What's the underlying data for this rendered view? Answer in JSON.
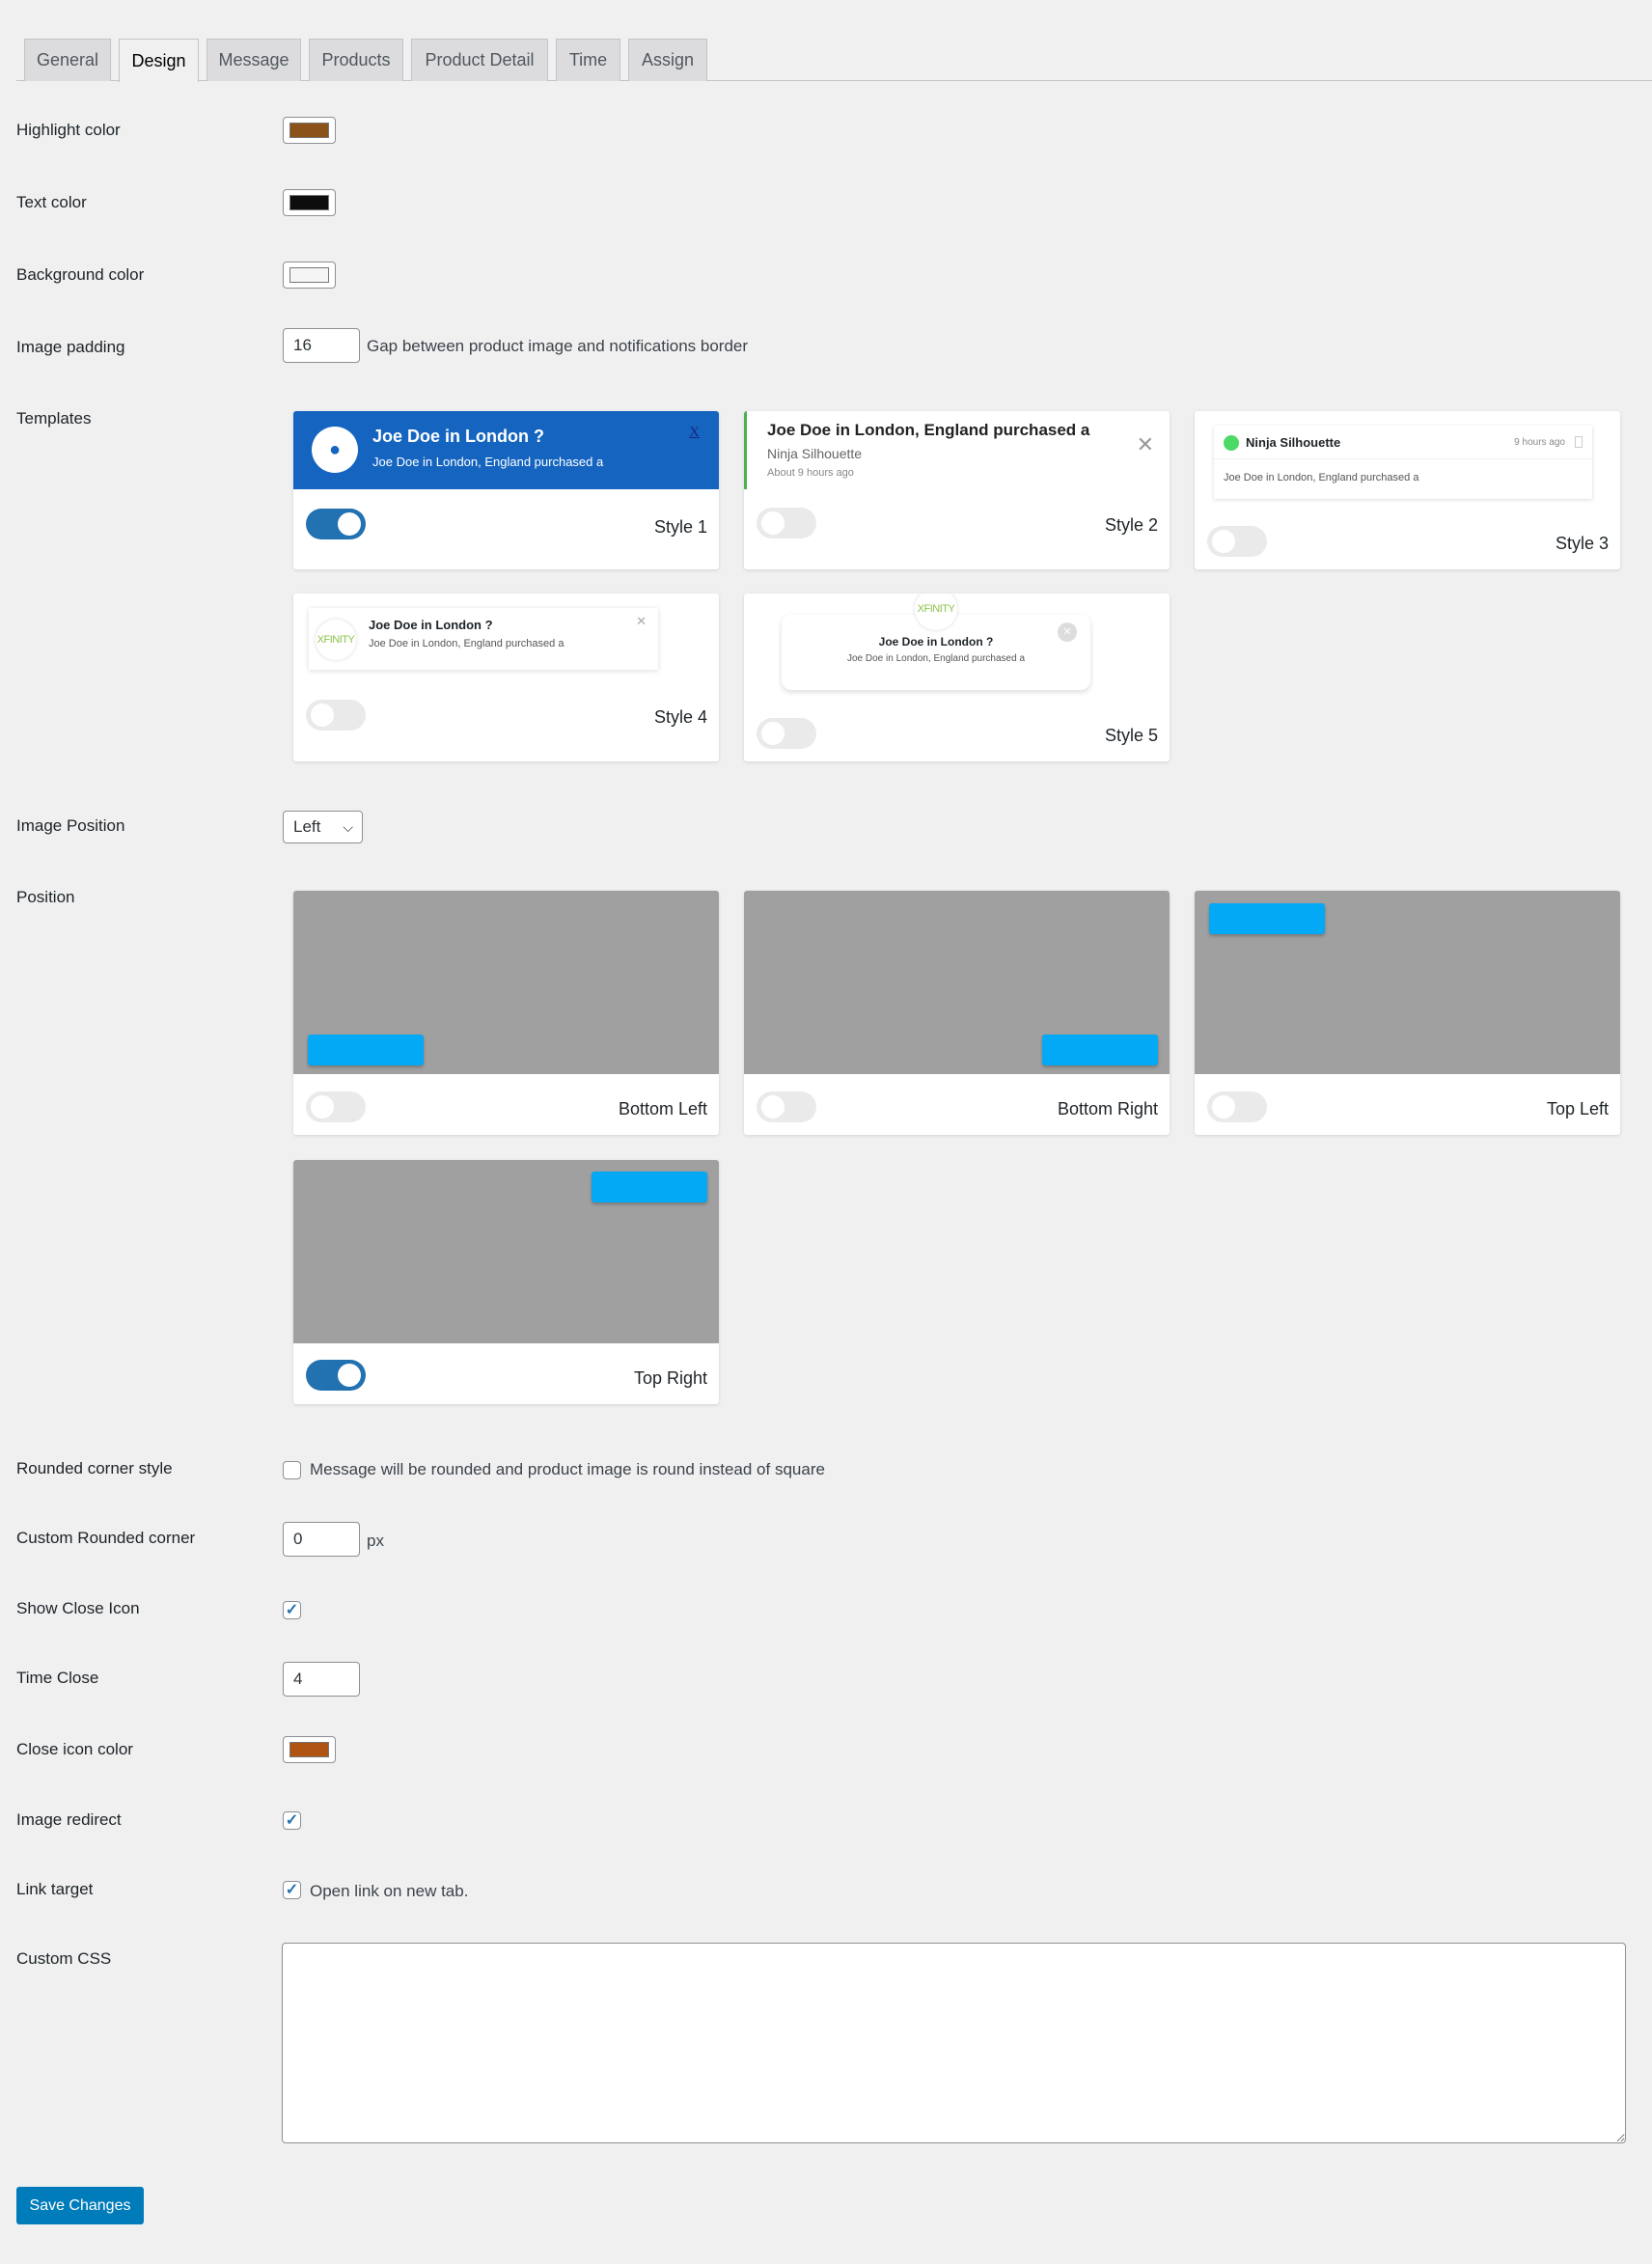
{
  "tabs": [
    "General",
    "Design",
    "Message",
    "Products",
    "Product Detail",
    "Time",
    "Assign"
  ],
  "active_tab": "Design",
  "fields": {
    "highlight_color": {
      "label": "Highlight color",
      "value": "#8b5219"
    },
    "text_color": {
      "label": "Text color",
      "value": "#0d0d0d"
    },
    "background_color": {
      "label": "Background color",
      "value": "#f5f5f5"
    },
    "image_padding": {
      "label": "Image padding",
      "value": "16",
      "description": "Gap between product image and notifications border"
    },
    "templates": {
      "label": "Templates"
    },
    "image_position": {
      "label": "Image Position",
      "value": "Left"
    },
    "position": {
      "label": "Position"
    },
    "rounded_corner": {
      "label": "Rounded corner style",
      "description": "Message will be rounded and product image is round instead of square",
      "checked": false
    },
    "custom_rounded": {
      "label": "Custom Rounded corner",
      "value": "0",
      "unit": "px"
    },
    "show_close": {
      "label": "Show Close Icon",
      "checked": true
    },
    "time_close": {
      "label": "Time Close",
      "value": "4"
    },
    "close_color": {
      "label": "Close icon color",
      "value": "#b05414"
    },
    "image_redirect": {
      "label": "Image redirect",
      "checked": true
    },
    "link_target": {
      "label": "Link target",
      "description": "Open link on new tab.",
      "checked": true
    },
    "custom_css": {
      "label": "Custom CSS",
      "value": ""
    }
  },
  "templates": [
    {
      "label": "Style 1",
      "enabled": true,
      "title": "Joe Doe in London ?",
      "text": "Joe Doe in London, England purchased a",
      "close": "X"
    },
    {
      "label": "Style 2",
      "enabled": false,
      "title": "Joe Doe in London, England purchased a",
      "name": "Ninja Silhouette",
      "time": "About 9 hours ago"
    },
    {
      "label": "Style 3",
      "enabled": false,
      "name": "Ninja Silhouette",
      "time": "9 hours ago",
      "text": "Joe Doe in London, England purchased a"
    },
    {
      "label": "Style 4",
      "enabled": false,
      "logo": "XFINITY",
      "title": "Joe Doe in London ?",
      "text": "Joe Doe in London, England purchased a"
    },
    {
      "label": "Style 5",
      "enabled": false,
      "logo": "XFINITY",
      "title": "Joe Doe in London ?",
      "text": "Joe Doe in London, England purchased a"
    }
  ],
  "positions": [
    {
      "label": "Bottom Left",
      "enabled": false
    },
    {
      "label": "Bottom Right",
      "enabled": false
    },
    {
      "label": "Top Left",
      "enabled": false
    },
    {
      "label": "Top Right",
      "enabled": true
    }
  ],
  "save_label": "Save Changes"
}
